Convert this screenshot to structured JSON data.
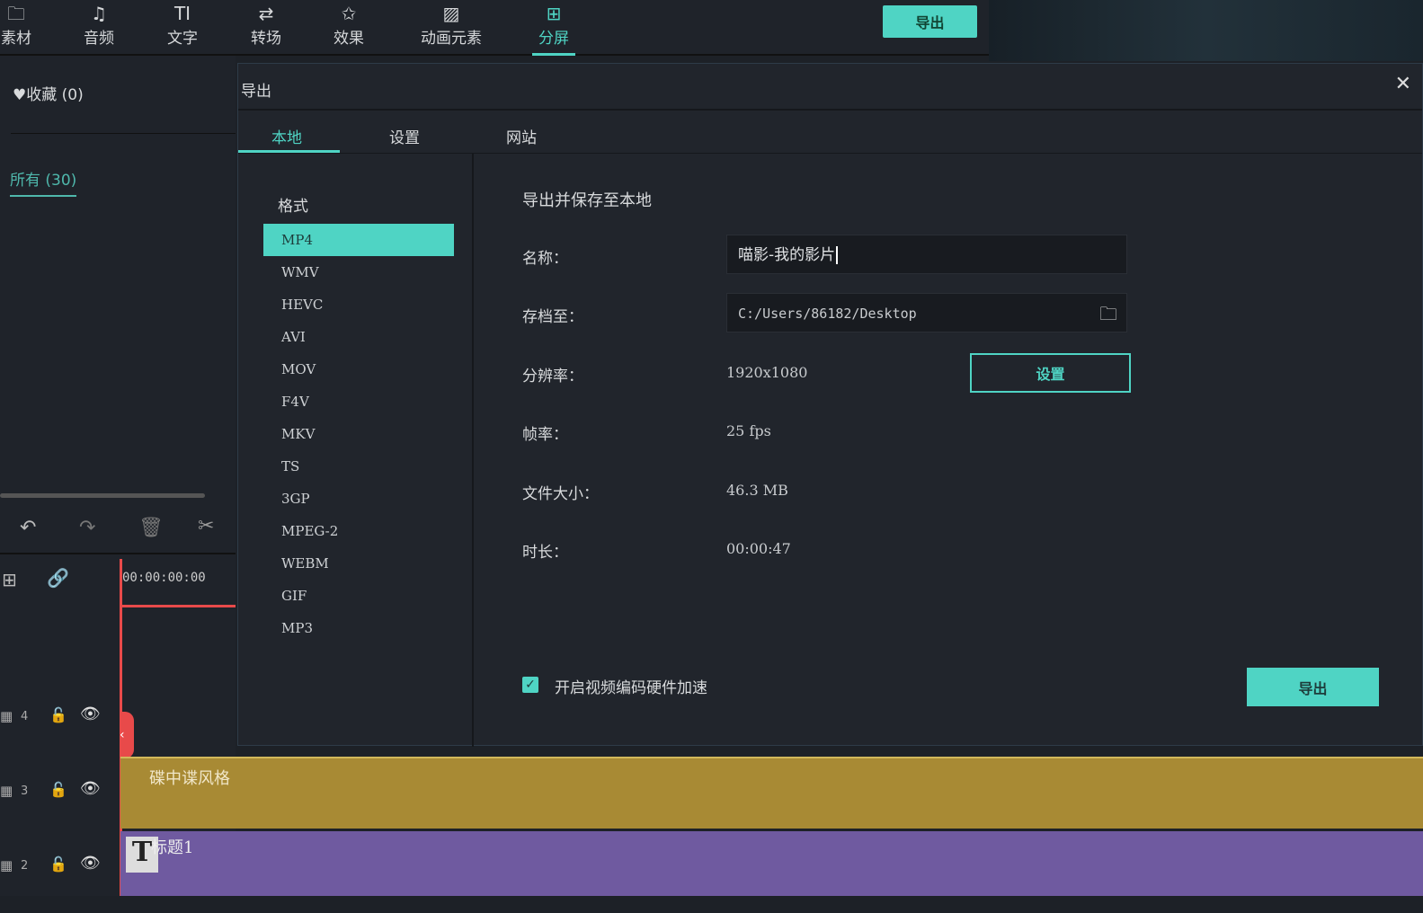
{
  "top_nav": {
    "items": [
      {
        "label": "素材",
        "icon": "folder-icon"
      },
      {
        "label": "音频",
        "icon": "music-note-icon"
      },
      {
        "label": "文字",
        "icon": "text-icon"
      },
      {
        "label": "转场",
        "icon": "transition-icon"
      },
      {
        "label": "效果",
        "icon": "effects-icon"
      },
      {
        "label": "动画元素",
        "icon": "image-icon"
      },
      {
        "label": "分屏",
        "icon": "split-screen-icon"
      }
    ],
    "active": "分屏",
    "export_label": "导出"
  },
  "sidebar": {
    "favorites": "收藏 (0)",
    "all": "所有 (30)"
  },
  "dialog": {
    "title": "导出",
    "tabs": [
      "本地",
      "设置",
      "网站"
    ],
    "format_heading": "格式",
    "formats": [
      "MP4",
      "WMV",
      "HEVC",
      "AVI",
      "MOV",
      "F4V",
      "MKV",
      "TS",
      "3GP",
      "MPEG-2",
      "WEBM",
      "GIF",
      "MP3"
    ],
    "selected_format": "MP4",
    "section_title": "导出并保存至本地",
    "name_label": "名称：",
    "name_value": "喵影-我的影片",
    "save_label": "存档至：",
    "save_value": "C:/Users/86182/Desktop",
    "resolution_label": "分辨率：",
    "resolution_value": "1920x1080",
    "settings_button": "设置",
    "fps_label": "帧率：",
    "fps_value": "25 fps",
    "size_label": "文件大小：",
    "size_value": "46.3 MB",
    "duration_label": "时长：",
    "duration_value": "00:00:47",
    "hw_accel_label": "开启视频编码硬件加速",
    "hw_accel_checked": true,
    "export_button": "导出"
  },
  "timeline": {
    "timecode": "00:00:00:00",
    "tracks": [
      {
        "num": "4"
      },
      {
        "num": "3"
      },
      {
        "num": "2"
      }
    ],
    "clip_yellow": "碟中谍风格",
    "clip_purple": "标题1"
  },
  "colors": {
    "accent": "#4fd4c4",
    "playhead": "#e84a4a",
    "clip_yellow": "#a88a34",
    "clip_purple": "#6f5aa0"
  }
}
